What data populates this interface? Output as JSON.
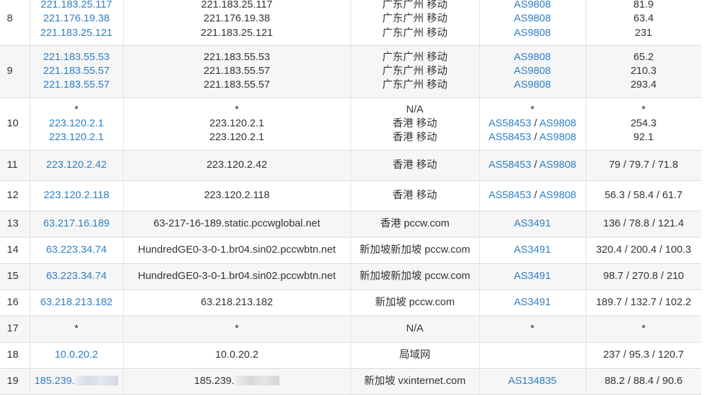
{
  "hops": [
    {
      "hop": "8",
      "ips": [
        "221.183.25.117",
        "221.176.19.38",
        "221.183.25.121"
      ],
      "hosts": [
        "221.183.25.117",
        "221.176.19.38",
        "221.183.25.121"
      ],
      "locations": [
        "广东广州 移动",
        "广东广州 移动",
        "广东广州 移动"
      ],
      "asns": [
        [
          "AS9808"
        ],
        [
          "AS9808"
        ],
        [
          "AS9808"
        ]
      ],
      "latencies": [
        "81.9",
        "63.4",
        "231"
      ]
    },
    {
      "hop": "9",
      "ips": [
        "221.183.55.53",
        "221.183.55.57",
        "221.183.55.57"
      ],
      "hosts": [
        "221.183.55.53",
        "221.183.55.57",
        "221.183.55.57"
      ],
      "locations": [
        "广东广州 移动",
        "广东广州 移动",
        "广东广州 移动"
      ],
      "asns": [
        [
          "AS9808"
        ],
        [
          "AS9808"
        ],
        [
          "AS9808"
        ]
      ],
      "latencies": [
        "65.2",
        "210.3",
        "293.4"
      ]
    },
    {
      "hop": "10",
      "ips": [
        "*",
        "223.120.2.1",
        "223.120.2.1"
      ],
      "hosts": [
        "*",
        "223.120.2.1",
        "223.120.2.1"
      ],
      "locations": [
        "N/A",
        "香港 移动",
        "香港 移动"
      ],
      "asns": [
        [
          "*"
        ],
        [
          "AS58453",
          "AS9808"
        ],
        [
          "AS58453",
          "AS9808"
        ]
      ],
      "latencies": [
        "*",
        "254.3",
        "92.1"
      ]
    },
    {
      "hop": "11",
      "ips": [
        "223.120.2.42"
      ],
      "hosts": [
        "223.120.2.42"
      ],
      "locations": [
        "香港 移动"
      ],
      "asns": [
        [
          "AS58453",
          "AS9808"
        ]
      ],
      "latencies": [
        "79 / 79.7 / 71.8"
      ]
    },
    {
      "hop": "12",
      "ips": [
        "223.120.2.118"
      ],
      "hosts": [
        "223.120.2.118"
      ],
      "locations": [
        "香港 移动"
      ],
      "asns": [
        [
          "AS58453",
          "AS9808"
        ]
      ],
      "latencies": [
        "56.3 / 58.4 / 61.7"
      ]
    },
    {
      "hop": "13",
      "ips": [
        "63.217.16.189"
      ],
      "hosts": [
        "63-217-16-189.static.pccwglobal.net"
      ],
      "locations": [
        "香港 pccw.com"
      ],
      "asns": [
        [
          "AS3491"
        ]
      ],
      "latencies": [
        "136 / 78.8 / 121.4"
      ]
    },
    {
      "hop": "14",
      "ips": [
        "63.223.34.74"
      ],
      "hosts": [
        "HundredGE0-3-0-1.br04.sin02.pccwbtn.net"
      ],
      "locations": [
        "新加坡新加坡 pccw.com"
      ],
      "asns": [
        [
          "AS3491"
        ]
      ],
      "latencies": [
        "320.4 / 200.4 / 100.3"
      ]
    },
    {
      "hop": "15",
      "ips": [
        "63.223.34.74"
      ],
      "hosts": [
        "HundredGE0-3-0-1.br04.sin02.pccwbtn.net"
      ],
      "locations": [
        "新加坡新加坡 pccw.com"
      ],
      "asns": [
        [
          "AS3491"
        ]
      ],
      "latencies": [
        "98.7 / 270.8 / 210"
      ]
    },
    {
      "hop": "16",
      "ips": [
        "63.218.213.182"
      ],
      "hosts": [
        "63.218.213.182"
      ],
      "locations": [
        "新加坡 pccw.com"
      ],
      "asns": [
        [
          "AS3491"
        ]
      ],
      "latencies": [
        "189.7 / 132.7 / 102.2"
      ]
    },
    {
      "hop": "17",
      "ips": [
        "*"
      ],
      "hosts": [
        "*"
      ],
      "locations": [
        "N/A"
      ],
      "asns": [
        [
          "*"
        ]
      ],
      "latencies": [
        "*"
      ]
    },
    {
      "hop": "18",
      "ips": [
        "10.0.20.2"
      ],
      "hosts": [
        "10.0.20.2"
      ],
      "locations": [
        "局域网"
      ],
      "asns": [
        []
      ],
      "latencies": [
        "237 / 95.3 / 120.7"
      ]
    },
    {
      "hop": "19",
      "ips": [
        "185.239."
      ],
      "hosts": [
        "185.239."
      ],
      "locations": [
        "新加坡 vxinternet.com"
      ],
      "asns": [
        [
          "AS134835"
        ]
      ],
      "latencies": [
        "88.2 / 88.4 / 90.6"
      ],
      "redacted": true
    }
  ],
  "asn_separator": " / ",
  "colors": {
    "link": "#2e7fc4",
    "text": "#333333",
    "row_alt_background": "#f6f6f6",
    "border": "#dcdcdc"
  }
}
